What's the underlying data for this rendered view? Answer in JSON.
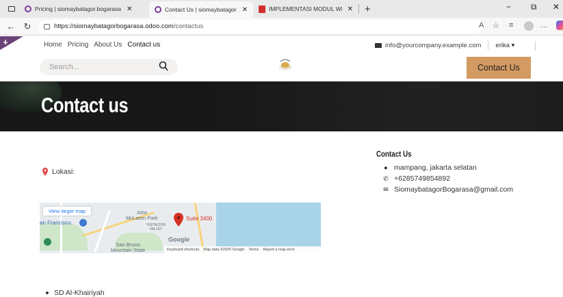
{
  "browser": {
    "tabs": [
      {
        "title": "Pricing | siomaybatagor.bogarasa"
      },
      {
        "title": "Contact Us | siomaybatagor.bogo"
      },
      {
        "title": "IMPLEMENTASI MODUL WEBSITE"
      }
    ],
    "url_main": "https://siomaybatagorbogarasa.odoo.com",
    "url_path": "/contactus",
    "minimize": "−",
    "restore": "⧉",
    "close": "✕",
    "new_tab": "+",
    "tab_close": "✕"
  },
  "nav": {
    "items": [
      "Home",
      "Pricing",
      "About Us",
      "Contact us"
    ],
    "email": "info@yourcompany.example.com",
    "user": "erika ▾"
  },
  "header": {
    "search_placeholder": "Search...",
    "contact_button": "Contact Us"
  },
  "hero": {
    "title": "Contact us"
  },
  "location": {
    "label": "Lokasi:"
  },
  "contact_info": {
    "title": "Contact Us",
    "address": "mampang, jakarta selatan",
    "phone": "+6285749854892",
    "email": "SiomaybatagorBogarasa@gmail.com"
  },
  "map": {
    "view_larger": "View larger map",
    "labels": {
      "john": "John\nMcLaren Park",
      "visitacion": "VISITACION\nVALLEY",
      "sf": "an Francisco",
      "sanbruno": "San Bruno\nMountain State",
      "suite": "Suite 3400",
      "google": "Google"
    },
    "footer": [
      "Keyboard shortcuts",
      "Map data ©2025 Google",
      "Terms",
      "Report a map error"
    ]
  },
  "list": {
    "items": [
      "SD Al-Khairiyah"
    ]
  },
  "colors": {
    "accent": "#d39a62",
    "hero_bg": "#171717",
    "pin": "#e04848"
  }
}
